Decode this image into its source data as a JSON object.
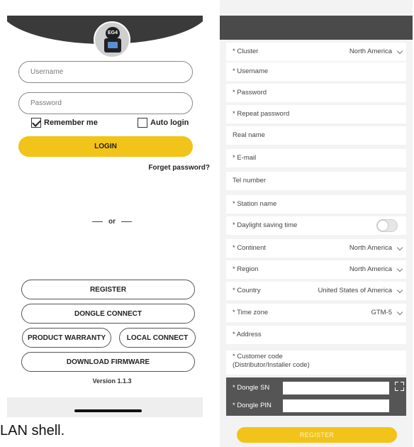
{
  "login": {
    "logo_text": "EG4",
    "username_placeholder": "Username",
    "password_placeholder": "Password",
    "remember_label": "Remember me",
    "remember_checked": true,
    "auto_login_label": "Auto login",
    "auto_login_checked": false,
    "login_button": "LOGIN",
    "forget_password": "Forget password?",
    "or_text": "or",
    "buttons": {
      "register": "REGISTER",
      "dongle_connect": "DONGLE CONNECT",
      "product_warranty": "PRODUCT WARRANTY",
      "local_connect": "LOCAL CONNECT",
      "download_firmware": "DOWNLOAD FIRMWARE"
    },
    "version": "Version 1.1.3"
  },
  "caption": "LAN shell.",
  "register_form": {
    "cluster": {
      "label": "* Cluster",
      "value": "North America"
    },
    "username": {
      "label": "* Username"
    },
    "password": {
      "label": "* Password"
    },
    "repeat_password": {
      "label": "* Repeat password"
    },
    "real_name": {
      "label": "Real name"
    },
    "email": {
      "label": "* E-mail"
    },
    "tel_number": {
      "label": "Tel number"
    },
    "station_name": {
      "label": "* Station name"
    },
    "daylight_saving": {
      "label": "* Daylight saving time",
      "enabled": false
    },
    "continent": {
      "label": "* Continent",
      "value": "North America"
    },
    "region": {
      "label": "* Region",
      "value": "North America"
    },
    "country": {
      "label": "* Country",
      "value": "United States of America"
    },
    "time_zone": {
      "label": "* Time zone",
      "value": "GTM-5"
    },
    "address": {
      "label": "* Address"
    },
    "customer_code": {
      "label": "* Customer code\n(Distributor/Installer code)"
    },
    "dongle_sn": {
      "label": "* Dongle SN"
    },
    "dongle_pin": {
      "label": "* Dongle PIN"
    },
    "register_button": "REGISTER"
  }
}
